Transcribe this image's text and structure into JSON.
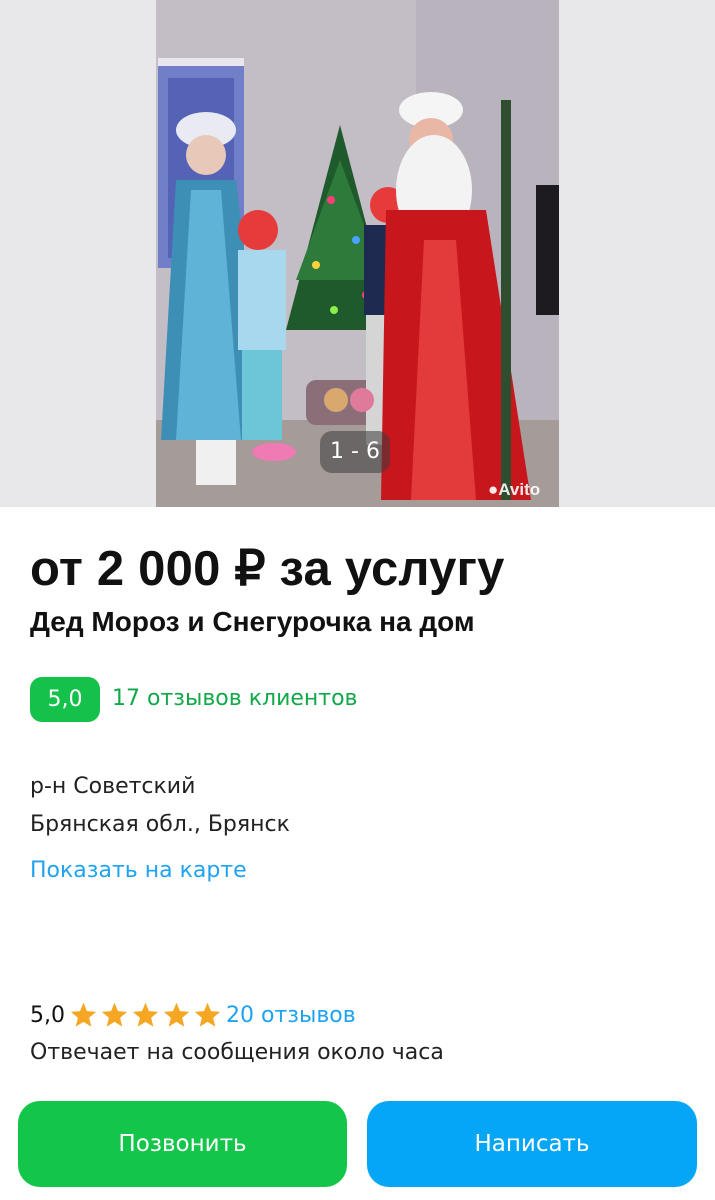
{
  "gallery": {
    "counter": "1 - 6",
    "watermark": "Avito"
  },
  "listing": {
    "price": "от 2 000 ₽ за услугу",
    "title": "Дед Мороз и Снегурочка на дом",
    "rating_badge": "5,0",
    "reviews_link": "17 отзывов клиентов"
  },
  "address": {
    "district": "р-н Советский",
    "city": "Брянская обл., Брянск",
    "map_link": "Показать на карте"
  },
  "seller": {
    "score": "5,0",
    "stars": 5,
    "reviews": "20 отзывов",
    "response_time": "Отвечает на сообщения около часа"
  },
  "actions": {
    "call": "Позвонить",
    "write": "Написать"
  },
  "colors": {
    "green": "#13c548",
    "blue": "#05a6f5",
    "star": "#f5a623"
  }
}
